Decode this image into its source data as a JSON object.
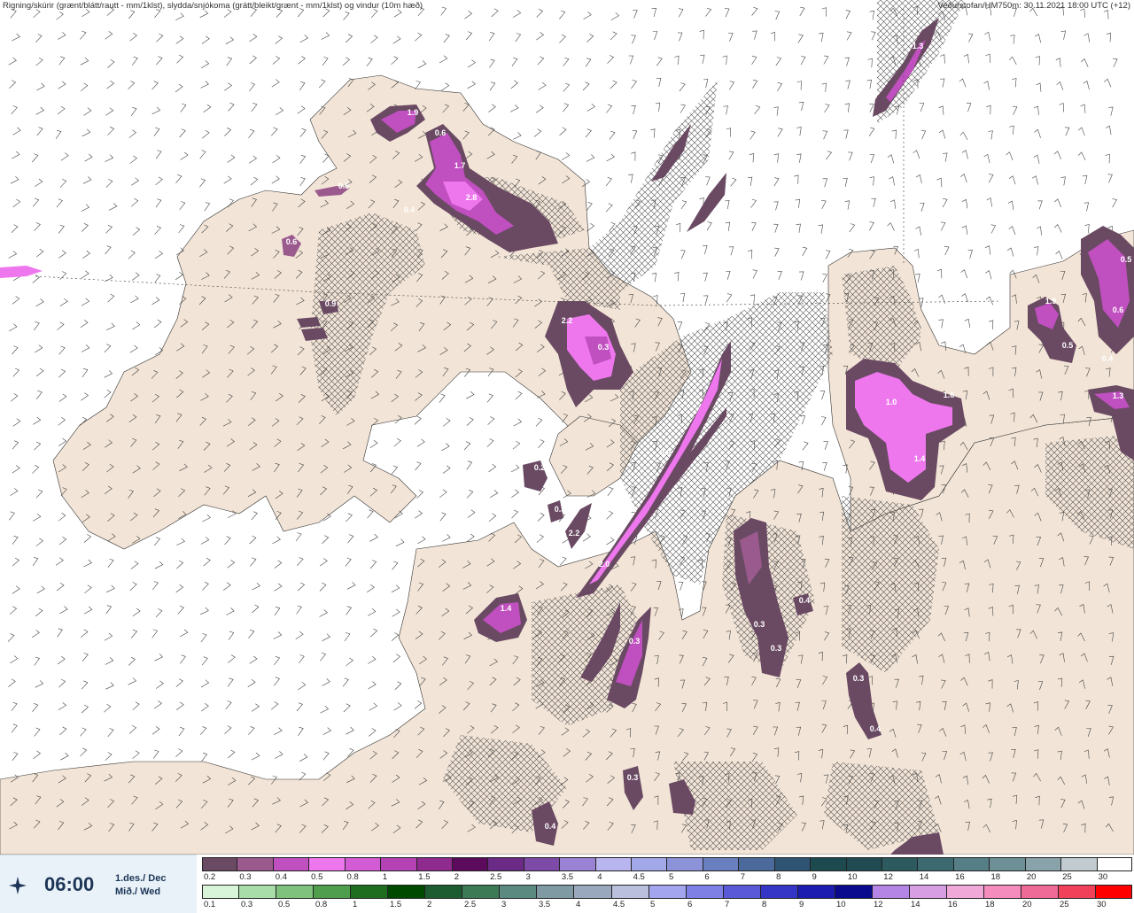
{
  "header": {
    "left": "Rigning/skúrir (grænt/blátt/rautt - mm/1klst), slydda/snjókoma (grátt/bleikt/grænt - mm/1klst) og vindur (10m hæð)",
    "right": "Veðurstofan/HM750m: 30.11.2021 18:00 UTC (+12)"
  },
  "time": {
    "value": "06:00",
    "date_line1": "1.des./ Dec",
    "date_line2": "Mið./ Wed",
    "icon": "compass-star-icon"
  },
  "scale_top": {
    "labels": [
      "0.2",
      "0.3",
      "0.4",
      "0.5",
      "0.8",
      "1",
      "1.5",
      "2",
      "2.5",
      "3",
      "3.5",
      "4",
      "4.5",
      "5",
      "6",
      "7",
      "8",
      "9",
      "10",
      "12",
      "14",
      "16",
      "18",
      "20",
      "25",
      "30"
    ],
    "colors": [
      "#6a4a63",
      "#9b5a8e",
      "#c04fbf",
      "#ee77ee",
      "#d35bd3",
      "#b542b5",
      "#8f2a8f",
      "#5c0a5c",
      "#6a2a85",
      "#7d4aa8",
      "#9a82d4",
      "#b9b6ef",
      "#a3a8e8",
      "#8c93d8",
      "#6a7fc0",
      "#4b6a9b",
      "#2f5473",
      "#1d4a4f",
      "#204b52",
      "#2c5a5e",
      "#3d6a70",
      "#557e86",
      "#6d8f96",
      "#8aa2aa",
      "#c2ccd0",
      "#ffffff"
    ]
  },
  "scale_bottom": {
    "labels": [
      "0.1",
      "0.3",
      "0.5",
      "0.8",
      "1",
      "1.5",
      "2",
      "2.5",
      "3",
      "3.5",
      "4",
      "4.5",
      "5",
      "6",
      "7",
      "8",
      "9",
      "10",
      "12",
      "14",
      "16",
      "18",
      "20",
      "25",
      "30"
    ],
    "colors": [
      "#d9f5d9",
      "#a8dca8",
      "#7ec27e",
      "#4e9e4e",
      "#1f6e1f",
      "#004a00",
      "#1c5c30",
      "#3b7a55",
      "#5a8a80",
      "#7f9aa3",
      "#9aa8bd",
      "#b9bfdc",
      "#a3a6ef",
      "#7f80e6",
      "#5a5ad8",
      "#3535c6",
      "#1c1cb0",
      "#0a0a8f",
      "#b585e6",
      "#d79ee3",
      "#f0a8d8",
      "#f58cbe",
      "#ef6a96",
      "#f0405a",
      "#ff0000"
    ]
  },
  "cell_labels_top": [
    "0.2",
    "0.3",
    "0.4",
    "0.5",
    "0.8",
    "1",
    "1.5",
    "2",
    "2.5",
    "3",
    "3.5",
    "4",
    "4.5",
    "5",
    "6",
    "7",
    "8",
    "9",
    "10",
    "12",
    "14",
    "16",
    "18",
    "20",
    "25"
  ],
  "precip_labels": [
    "1.9",
    "0.6",
    "1.7",
    "2.8",
    "0.4",
    "0.5",
    "0.6",
    "0.9",
    "2.2",
    "0.3",
    "0.2",
    "0.3",
    "2.2",
    "2.0",
    "0.9",
    "1.4",
    "1.0",
    "1.6",
    "1.4",
    "0.3",
    "0.3",
    "0.3",
    "0.4",
    "0.3",
    "0.4",
    "0.3",
    "0.4",
    "1.3",
    "1.9",
    "0.5",
    "0.4",
    "1.3",
    "0.5",
    "0.6"
  ]
}
